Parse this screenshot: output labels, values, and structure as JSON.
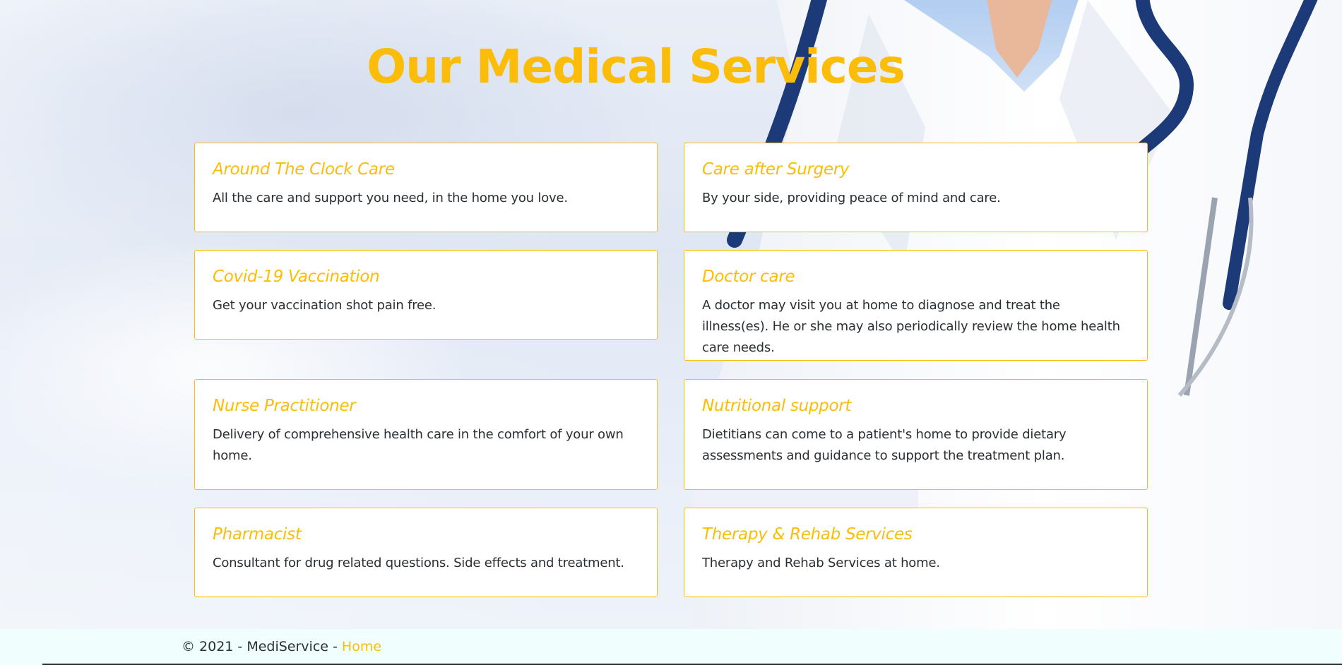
{
  "page": {
    "title": "Our Medical Services"
  },
  "services": [
    {
      "title": "Around The Clock Care",
      "description": "All the care and support you need, in the home you love."
    },
    {
      "title": "Care after Surgery",
      "description": "By your side, providing peace of mind and care."
    },
    {
      "title": "Covid-19 Vaccination",
      "description": "Get your vaccination shot pain free."
    },
    {
      "title": "Doctor care",
      "description": "A doctor may visit you at home to diagnose and treat the illness(es). He or she may also periodically review the home health care needs."
    },
    {
      "title": "Nurse Practitioner",
      "description": "Delivery of comprehensive health care in the comfort of your own home."
    },
    {
      "title": "Nutritional support",
      "description": "Dietitians can come to a patient's home to provide dietary assessments and guidance to support the treatment plan."
    },
    {
      "title": "Pharmacist",
      "description": "Consultant for drug related questions. Side effects and treatment."
    },
    {
      "title": "Therapy & Rehab Services",
      "description": "Therapy and Rehab Services at home."
    }
  ],
  "footer": {
    "copyright": "© 2021 - MediService - ",
    "home_link": "Home"
  },
  "colors": {
    "accent": "#fbbd0a",
    "text": "#2a2f33",
    "footer_bg": "#f0fffe",
    "card_bg": "#ffffff"
  }
}
